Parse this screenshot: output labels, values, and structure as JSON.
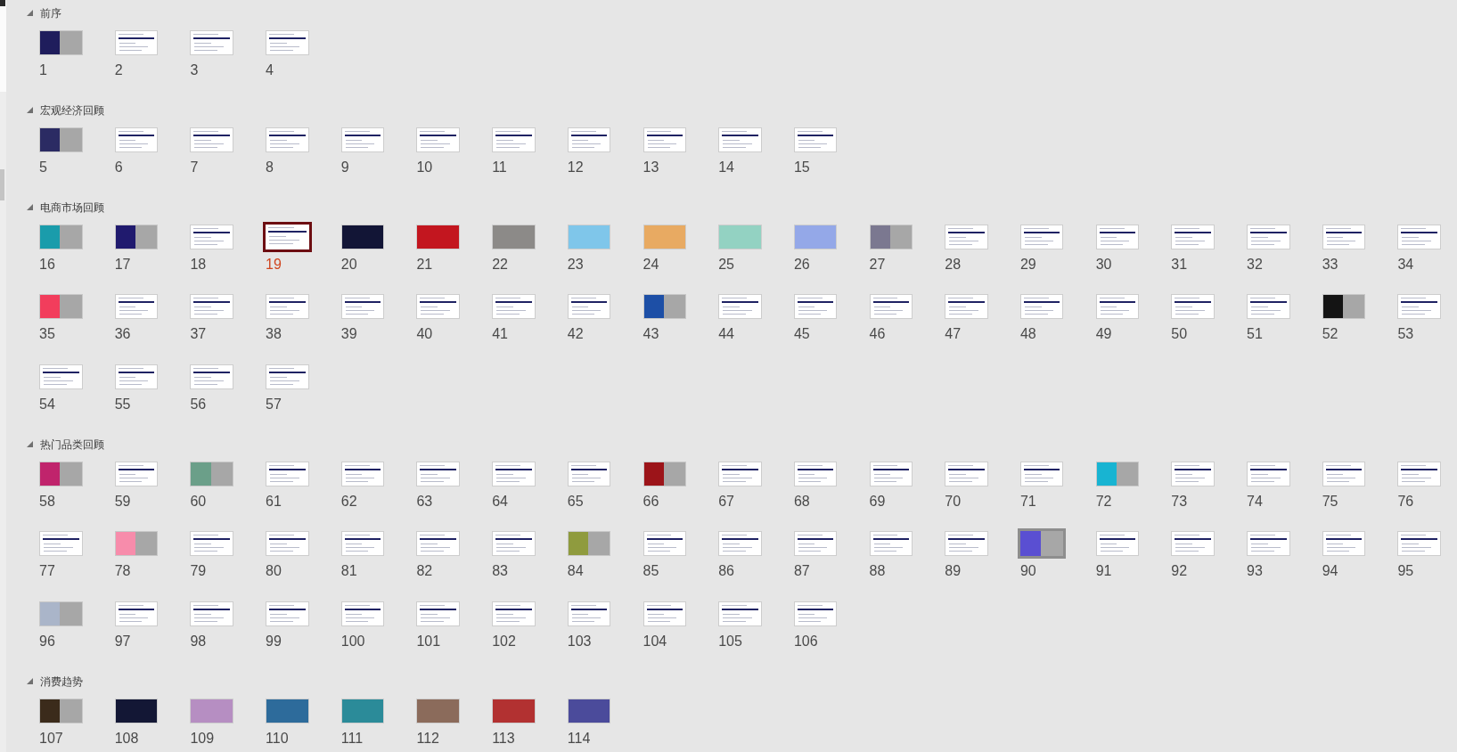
{
  "sections": [
    {
      "title": "前序",
      "expanded": true,
      "slides": [
        {
          "number": "1",
          "kind": "split",
          "color": "#1f1d5c",
          "selected": false,
          "hover": false
        },
        {
          "number": "2",
          "kind": "content",
          "selected": false,
          "hover": false
        },
        {
          "number": "3",
          "kind": "content",
          "selected": false,
          "hover": false
        },
        {
          "number": "4",
          "kind": "content",
          "selected": false,
          "hover": false
        }
      ]
    },
    {
      "title": "宏观经济回顾",
      "expanded": true,
      "slides": [
        {
          "number": "5",
          "kind": "split",
          "color": "#2b2b63",
          "selected": false,
          "hover": false
        },
        {
          "number": "6",
          "kind": "content",
          "selected": false,
          "hover": false
        },
        {
          "number": "7",
          "kind": "content",
          "selected": false,
          "hover": false
        },
        {
          "number": "8",
          "kind": "content",
          "selected": false,
          "hover": false
        },
        {
          "number": "9",
          "kind": "content",
          "selected": false,
          "hover": false
        },
        {
          "number": "10",
          "kind": "content",
          "selected": false,
          "hover": false
        },
        {
          "number": "11",
          "kind": "content",
          "selected": false,
          "hover": false
        },
        {
          "number": "12",
          "kind": "content",
          "selected": false,
          "hover": false
        },
        {
          "number": "13",
          "kind": "content",
          "selected": false,
          "hover": false
        },
        {
          "number": "14",
          "kind": "content",
          "selected": false,
          "hover": false
        },
        {
          "number": "15",
          "kind": "content",
          "selected": false,
          "hover": false
        }
      ]
    },
    {
      "title": "电商市场回顾",
      "expanded": true,
      "slides": [
        {
          "number": "16",
          "kind": "split",
          "color": "#1a9cab",
          "selected": false,
          "hover": false
        },
        {
          "number": "17",
          "kind": "split",
          "color": "#201a6e",
          "selected": false,
          "hover": false
        },
        {
          "number": "18",
          "kind": "content",
          "selected": false,
          "hover": false
        },
        {
          "number": "19",
          "kind": "content",
          "selected": true,
          "hover": false
        },
        {
          "number": "20",
          "kind": "cover",
          "color": "#121536",
          "selected": false,
          "hover": false
        },
        {
          "number": "21",
          "kind": "cover",
          "color": "#c3161f",
          "selected": false,
          "hover": false
        },
        {
          "number": "22",
          "kind": "cover",
          "color": "#8c8a88",
          "selected": false,
          "hover": false
        },
        {
          "number": "23",
          "kind": "cover",
          "color": "#7fc6ea",
          "selected": false,
          "hover": false
        },
        {
          "number": "24",
          "kind": "cover",
          "color": "#e8aa62",
          "selected": false,
          "hover": false
        },
        {
          "number": "25",
          "kind": "cover",
          "color": "#93d2c2",
          "selected": false,
          "hover": false
        },
        {
          "number": "26",
          "kind": "cover",
          "color": "#94a8e8",
          "selected": false,
          "hover": false
        },
        {
          "number": "27",
          "kind": "split",
          "color": "#7b7890",
          "selected": false,
          "hover": false
        },
        {
          "number": "28",
          "kind": "content",
          "selected": false,
          "hover": false
        },
        {
          "number": "29",
          "kind": "content",
          "selected": false,
          "hover": false
        },
        {
          "number": "30",
          "kind": "content",
          "selected": false,
          "hover": false
        },
        {
          "number": "31",
          "kind": "content",
          "selected": false,
          "hover": false
        },
        {
          "number": "32",
          "kind": "content",
          "selected": false,
          "hover": false
        },
        {
          "number": "33",
          "kind": "content",
          "selected": false,
          "hover": false
        },
        {
          "number": "34",
          "kind": "content",
          "selected": false,
          "hover": false
        },
        {
          "number": "35",
          "kind": "split",
          "color": "#f23d5c",
          "selected": false,
          "hover": false
        },
        {
          "number": "36",
          "kind": "content",
          "selected": false,
          "hover": false
        },
        {
          "number": "37",
          "kind": "content",
          "selected": false,
          "hover": false
        },
        {
          "number": "38",
          "kind": "content",
          "selected": false,
          "hover": false
        },
        {
          "number": "39",
          "kind": "content",
          "selected": false,
          "hover": false
        },
        {
          "number": "40",
          "kind": "content",
          "selected": false,
          "hover": false
        },
        {
          "number": "41",
          "kind": "content",
          "selected": false,
          "hover": false
        },
        {
          "number": "42",
          "kind": "content",
          "selected": false,
          "hover": false
        },
        {
          "number": "43",
          "kind": "split",
          "color": "#1d4fa6",
          "selected": false,
          "hover": false
        },
        {
          "number": "44",
          "kind": "content",
          "selected": false,
          "hover": false
        },
        {
          "number": "45",
          "kind": "content",
          "selected": false,
          "hover": false
        },
        {
          "number": "46",
          "kind": "content",
          "selected": false,
          "hover": false
        },
        {
          "number": "47",
          "kind": "content",
          "selected": false,
          "hover": false
        },
        {
          "number": "48",
          "kind": "content",
          "selected": false,
          "hover": false
        },
        {
          "number": "49",
          "kind": "content",
          "selected": false,
          "hover": false
        },
        {
          "number": "50",
          "kind": "content",
          "selected": false,
          "hover": false
        },
        {
          "number": "51",
          "kind": "content",
          "selected": false,
          "hover": false
        },
        {
          "number": "52",
          "kind": "split",
          "color": "#141414",
          "selected": false,
          "hover": false
        },
        {
          "number": "53",
          "kind": "content",
          "selected": false,
          "hover": false
        },
        {
          "number": "54",
          "kind": "content",
          "selected": false,
          "hover": false
        },
        {
          "number": "55",
          "kind": "content",
          "selected": false,
          "hover": false
        },
        {
          "number": "56",
          "kind": "content",
          "selected": false,
          "hover": false
        },
        {
          "number": "57",
          "kind": "content",
          "selected": false,
          "hover": false
        }
      ]
    },
    {
      "title": "热门品类回顾",
      "expanded": true,
      "slides": [
        {
          "number": "58",
          "kind": "split",
          "color": "#c0246c",
          "selected": false,
          "hover": false
        },
        {
          "number": "59",
          "kind": "content",
          "selected": false,
          "hover": false
        },
        {
          "number": "60",
          "kind": "split",
          "color": "#6b9f89",
          "selected": false,
          "hover": false
        },
        {
          "number": "61",
          "kind": "content",
          "selected": false,
          "hover": false
        },
        {
          "number": "62",
          "kind": "content",
          "selected": false,
          "hover": false
        },
        {
          "number": "63",
          "kind": "content",
          "selected": false,
          "hover": false
        },
        {
          "number": "64",
          "kind": "content",
          "selected": false,
          "hover": false
        },
        {
          "number": "65",
          "kind": "content",
          "selected": false,
          "hover": false
        },
        {
          "number": "66",
          "kind": "split",
          "color": "#9c1419",
          "selected": false,
          "hover": false
        },
        {
          "number": "67",
          "kind": "content",
          "selected": false,
          "hover": false
        },
        {
          "number": "68",
          "kind": "content",
          "selected": false,
          "hover": false
        },
        {
          "number": "69",
          "kind": "content",
          "selected": false,
          "hover": false
        },
        {
          "number": "70",
          "kind": "content",
          "selected": false,
          "hover": false
        },
        {
          "number": "71",
          "kind": "content",
          "selected": false,
          "hover": false
        },
        {
          "number": "72",
          "kind": "split",
          "color": "#18b4d2",
          "selected": false,
          "hover": false
        },
        {
          "number": "73",
          "kind": "content",
          "selected": false,
          "hover": false
        },
        {
          "number": "74",
          "kind": "content",
          "selected": false,
          "hover": false
        },
        {
          "number": "75",
          "kind": "content",
          "selected": false,
          "hover": false
        },
        {
          "number": "76",
          "kind": "content",
          "selected": false,
          "hover": false
        },
        {
          "number": "77",
          "kind": "content",
          "selected": false,
          "hover": false
        },
        {
          "number": "78",
          "kind": "split",
          "color": "#f78cab",
          "selected": false,
          "hover": false
        },
        {
          "number": "79",
          "kind": "content",
          "selected": false,
          "hover": false
        },
        {
          "number": "80",
          "kind": "content",
          "selected": false,
          "hover": false
        },
        {
          "number": "81",
          "kind": "content",
          "selected": false,
          "hover": false
        },
        {
          "number": "82",
          "kind": "content",
          "selected": false,
          "hover": false
        },
        {
          "number": "83",
          "kind": "content",
          "selected": false,
          "hover": false
        },
        {
          "number": "84",
          "kind": "split",
          "color": "#8f9b3e",
          "selected": false,
          "hover": false
        },
        {
          "number": "85",
          "kind": "content",
          "selected": false,
          "hover": false
        },
        {
          "number": "86",
          "kind": "content",
          "selected": false,
          "hover": false
        },
        {
          "number": "87",
          "kind": "content",
          "selected": false,
          "hover": false
        },
        {
          "number": "88",
          "kind": "content",
          "selected": false,
          "hover": false
        },
        {
          "number": "89",
          "kind": "content",
          "selected": false,
          "hover": false
        },
        {
          "number": "90",
          "kind": "split",
          "color": "#5a4fd2",
          "selected": false,
          "hover": true
        },
        {
          "number": "91",
          "kind": "content",
          "selected": false,
          "hover": false
        },
        {
          "number": "92",
          "kind": "content",
          "selected": false,
          "hover": false
        },
        {
          "number": "93",
          "kind": "content",
          "selected": false,
          "hover": false
        },
        {
          "number": "94",
          "kind": "content",
          "selected": false,
          "hover": false
        },
        {
          "number": "95",
          "kind": "content",
          "selected": false,
          "hover": false
        },
        {
          "number": "96",
          "kind": "split",
          "color": "#aab5c9",
          "selected": false,
          "hover": false
        },
        {
          "number": "97",
          "kind": "content",
          "selected": false,
          "hover": false
        },
        {
          "number": "98",
          "kind": "content",
          "selected": false,
          "hover": false
        },
        {
          "number": "99",
          "kind": "content",
          "selected": false,
          "hover": false
        },
        {
          "number": "100",
          "kind": "content",
          "selected": false,
          "hover": false
        },
        {
          "number": "101",
          "kind": "content",
          "selected": false,
          "hover": false
        },
        {
          "number": "102",
          "kind": "content",
          "selected": false,
          "hover": false
        },
        {
          "number": "103",
          "kind": "content",
          "selected": false,
          "hover": false
        },
        {
          "number": "104",
          "kind": "content",
          "selected": false,
          "hover": false
        },
        {
          "number": "105",
          "kind": "content",
          "selected": false,
          "hover": false
        },
        {
          "number": "106",
          "kind": "content",
          "selected": false,
          "hover": false
        }
      ]
    },
    {
      "title": "消费趋势",
      "expanded": true,
      "slides": [
        {
          "number": "107",
          "kind": "split",
          "color": "#3b2b1b",
          "selected": false,
          "hover": false
        },
        {
          "number": "108",
          "kind": "cover",
          "color": "#131735",
          "selected": false,
          "hover": false
        },
        {
          "number": "109",
          "kind": "cover",
          "color": "#b68ec2",
          "selected": false,
          "hover": false
        },
        {
          "number": "110",
          "kind": "cover",
          "color": "#2d6b9b",
          "selected": false,
          "hover": false
        },
        {
          "number": "111",
          "kind": "cover",
          "color": "#2b8b99",
          "selected": false,
          "hover": false
        },
        {
          "number": "112",
          "kind": "cover",
          "color": "#8b6b5b",
          "selected": false,
          "hover": false
        },
        {
          "number": "113",
          "kind": "cover",
          "color": "#b23131",
          "selected": false,
          "hover": false
        },
        {
          "number": "114",
          "kind": "cover",
          "color": "#4b4b9b",
          "selected": false,
          "hover": false
        }
      ]
    }
  ]
}
